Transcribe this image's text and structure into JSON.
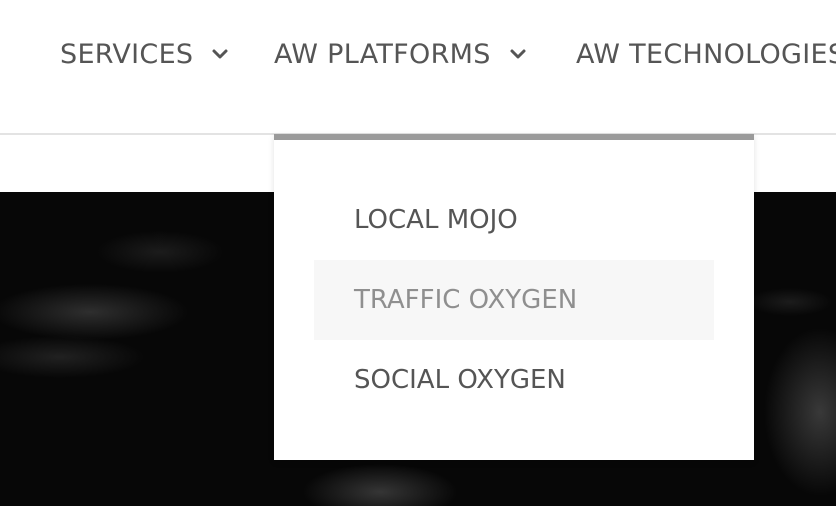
{
  "nav": {
    "items": [
      {
        "label": "SERVICES",
        "icon": "chevron-down-icon"
      },
      {
        "label": "AW PLATFORMS",
        "icon": "chevron-down-icon"
      },
      {
        "label": "AW TECHNOLOGIES",
        "icon": ""
      }
    ]
  },
  "dropdown": {
    "items": [
      {
        "label": "LOCAL MOJO"
      },
      {
        "label": "TRAFFIC OXYGEN",
        "state": "hover"
      },
      {
        "label": "SOCIAL OXYGEN"
      }
    ]
  },
  "colors": {
    "nav_text": "#555555",
    "dropdown_top_border": "#9a9a9a",
    "hover_background": "#f7f7f7",
    "hover_text": "#8f8f8f",
    "hero_background": "#070707"
  }
}
